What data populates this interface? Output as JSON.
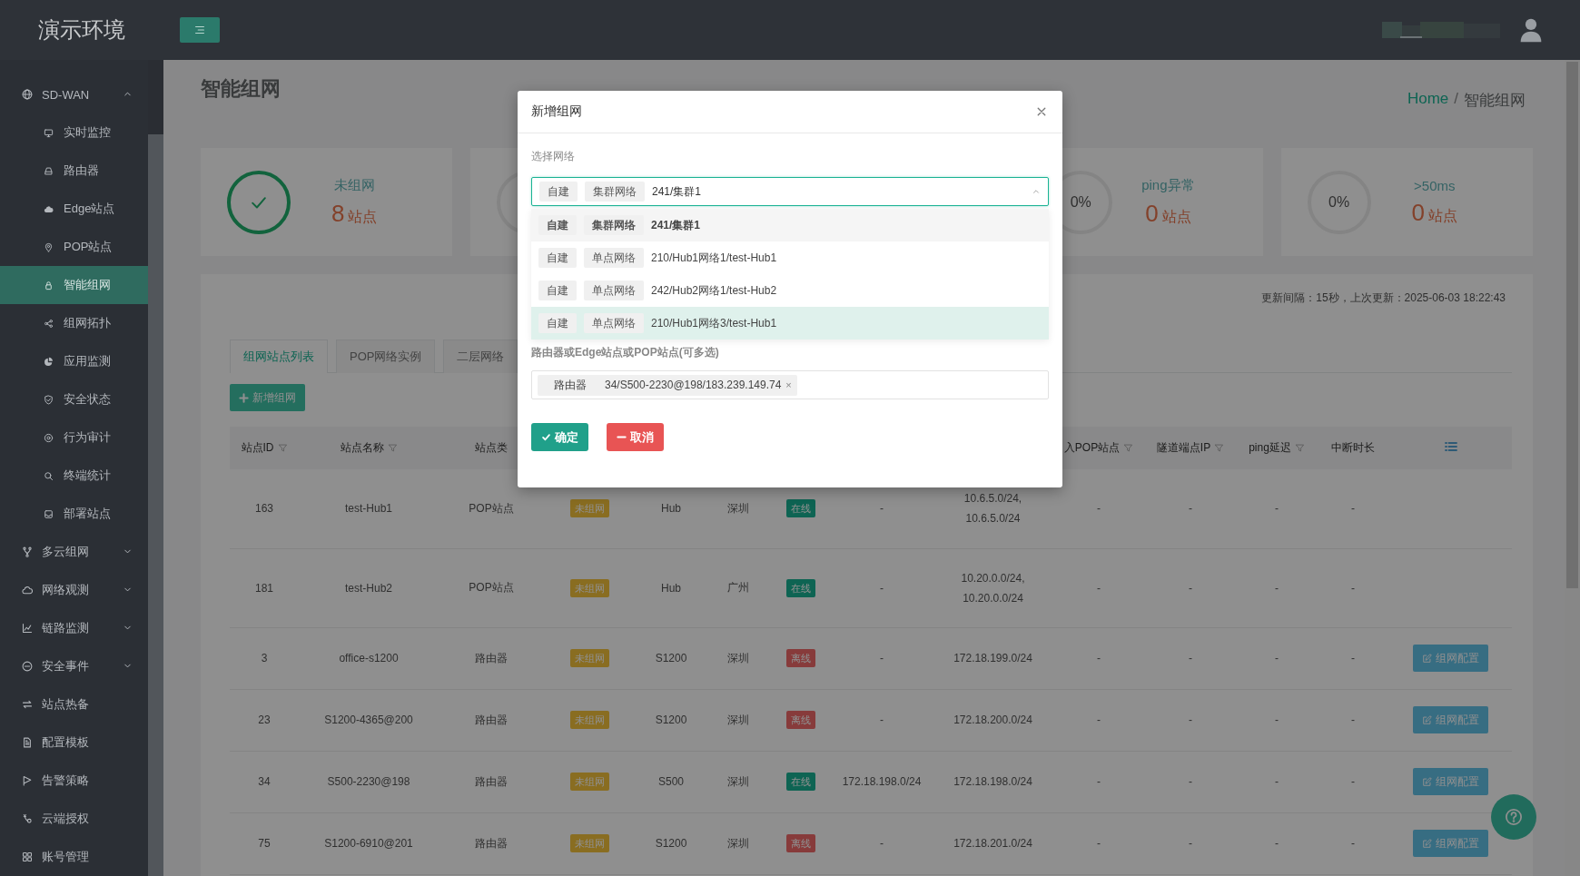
{
  "header": {
    "logo": "演示环境"
  },
  "sidebar": {
    "items": [
      {
        "label": "SD-WAN",
        "expanded": true,
        "selected": false,
        "children": [
          {
            "label": "实时监控",
            "selected": false
          },
          {
            "label": "路由器",
            "selected": false
          },
          {
            "label": "Edge站点",
            "selected": false
          },
          {
            "label": "POP站点",
            "selected": false
          },
          {
            "label": "智能组网",
            "selected": true
          },
          {
            "label": "组网拓扑",
            "selected": false
          },
          {
            "label": "应用监测",
            "selected": false
          },
          {
            "label": "安全状态",
            "selected": false
          },
          {
            "label": "行为审计",
            "selected": false
          },
          {
            "label": "终端统计",
            "selected": false
          },
          {
            "label": "部署站点",
            "selected": false
          }
        ]
      },
      {
        "label": "多云组网",
        "expanded": false,
        "selected": false
      },
      {
        "label": "网络观测",
        "expanded": false,
        "selected": false
      },
      {
        "label": "链路监测",
        "expanded": false,
        "selected": false
      },
      {
        "label": "安全事件",
        "expanded": false,
        "selected": false
      },
      {
        "label": "站点热备",
        "selected": false
      },
      {
        "label": "配置模板",
        "selected": false
      },
      {
        "label": "告警策略",
        "selected": false
      },
      {
        "label": "云端授权",
        "selected": false
      },
      {
        "label": "账号管理",
        "selected": false
      }
    ]
  },
  "page": {
    "title": "智能组网",
    "breadcrumb": {
      "home": "Home",
      "separator": "/",
      "current": "智能组网"
    }
  },
  "stats": [
    {
      "kind": "check",
      "label": "未组网",
      "value": "8",
      "unit": "站点"
    },
    {
      "kind": "ring"
    },
    {
      "kind": "ring",
      "ring_text": "0%",
      "label": "ping异常",
      "value": "0",
      "unit": "站点"
    },
    {
      "kind": "ring",
      "ring_text": "0%",
      "label": ">50ms",
      "value": "0",
      "unit": "站点"
    }
  ],
  "update_info": "更新间隔：15秒，上次更新：2025-06-03 18:22:43",
  "tabs": [
    {
      "label": "组网站点列表",
      "selected": true
    },
    {
      "label": "POP网络实例",
      "selected": false
    },
    {
      "label": "二层网络",
      "selected": false
    }
  ],
  "add_button": "新增组网",
  "table": {
    "columns": [
      {
        "label": "站点ID",
        "filter": true
      },
      {
        "label": "站点名称",
        "filter": true
      },
      {
        "label": "站点类",
        "filter": false
      },
      {},
      {},
      {},
      {},
      {},
      {},
      {
        "label": "入POP站点",
        "filter": true
      },
      {
        "label": "隧道端点IP",
        "filter": true
      },
      {
        "label": "ping延迟",
        "filter": true
      },
      {
        "label": "中断时长",
        "filter": false
      },
      {
        "kind": "settings"
      }
    ],
    "rows": [
      {
        "id": "163",
        "name": "test-Hub1",
        "type": "POP站点",
        "group_status": {
          "label": "未组网",
          "grouped": false
        },
        "model": "Hub",
        "city": "深圳",
        "online_status": {
          "label": "在线",
          "online": true
        },
        "column_8": "-",
        "column_9": [
          "10.6.5.0/24,",
          "10.6.5.0/24"
        ],
        "column_10": "-",
        "tunnel_ip": "-",
        "ping": "-",
        "downtime": "-"
      },
      {
        "id": "181",
        "name": "test-Hub2",
        "type": "POP站点",
        "group_status": {
          "label": "未组网",
          "grouped": false
        },
        "model": "Hub",
        "city": "广州",
        "online_status": {
          "label": "在线",
          "online": true
        },
        "column_8": "-",
        "column_9": [
          "10.20.0.0/24,",
          "10.20.0.0/24"
        ],
        "column_10": "-",
        "tunnel_ip": "-",
        "ping": "-",
        "downtime": "-"
      },
      {
        "id": "3",
        "name": "office-s1200",
        "type": "路由器",
        "group_status": {
          "label": "未组网",
          "grouped": false
        },
        "model": "S1200",
        "city": "深圳",
        "online_status": {
          "label": "离线",
          "online": false
        },
        "column_8": "-",
        "column_9": [
          "172.18.199.0/24"
        ],
        "column_10": "-",
        "tunnel_ip": "-",
        "ping": "-",
        "downtime": "-",
        "action": "组网配置"
      },
      {
        "id": "23",
        "name": "S1200-4365@200",
        "type": "路由器",
        "group_status": {
          "label": "未组网",
          "grouped": false
        },
        "model": "S1200",
        "city": "深圳",
        "online_status": {
          "label": "离线",
          "online": false
        },
        "column_8": "-",
        "column_9": [
          "172.18.200.0/24"
        ],
        "column_10": "-",
        "tunnel_ip": "-",
        "ping": "-",
        "downtime": "-",
        "action": "组网配置"
      },
      {
        "id": "34",
        "name": "S500-2230@198",
        "type": "路由器",
        "group_status": {
          "label": "未组网",
          "grouped": false
        },
        "model": "S500",
        "city": "深圳",
        "online_status": {
          "label": "在线",
          "online": true
        },
        "column_8": "172.18.198.0/24",
        "column_9": [
          "172.18.198.0/24"
        ],
        "column_10": "-",
        "tunnel_ip": "-",
        "ping": "-",
        "downtime": "-",
        "action": "组网配置"
      },
      {
        "id": "75",
        "name": "S1200-6910@201",
        "type": "路由器",
        "group_status": {
          "label": "未组网",
          "grouped": false
        },
        "model": "S1200",
        "city": "深圳",
        "online_status": {
          "label": "离线",
          "online": false
        },
        "column_8": "-",
        "column_9": [
          "172.18.201.0/24"
        ],
        "column_10": "-",
        "tunnel_ip": "-",
        "ping": "-",
        "downtime": "-",
        "action": "组网配置"
      }
    ]
  },
  "modal": {
    "title": "新增组网",
    "network_label": "选择网络",
    "network_select": {
      "tags": [
        "自建",
        "集群网络"
      ],
      "value": "241/集群1",
      "open": true
    },
    "options": [
      {
        "tags": [
          "自建",
          "集群网络"
        ],
        "label": "241/集群1",
        "selected": true,
        "highlighted": false
      },
      {
        "tags": [
          "自建",
          "单点网络"
        ],
        "label": "210/Hub1网络1/test-Hub1",
        "selected": false,
        "highlighted": false
      },
      {
        "tags": [
          "自建",
          "单点网络"
        ],
        "label": "242/Hub2网络1/test-Hub2",
        "selected": false,
        "highlighted": false
      },
      {
        "tags": [
          "自建",
          "单点网络"
        ],
        "label": "210/Hub1网络3/test-Hub1",
        "selected": false,
        "highlighted": true
      }
    ],
    "sites_label": "路由器或Edge站点或POP站点(可多选)",
    "sites": [
      {
        "type": "路由器",
        "value": "34/S500-2230@198/183.239.149.74",
        "remove": "×"
      }
    ],
    "confirm": "确定",
    "cancel": "取消"
  }
}
